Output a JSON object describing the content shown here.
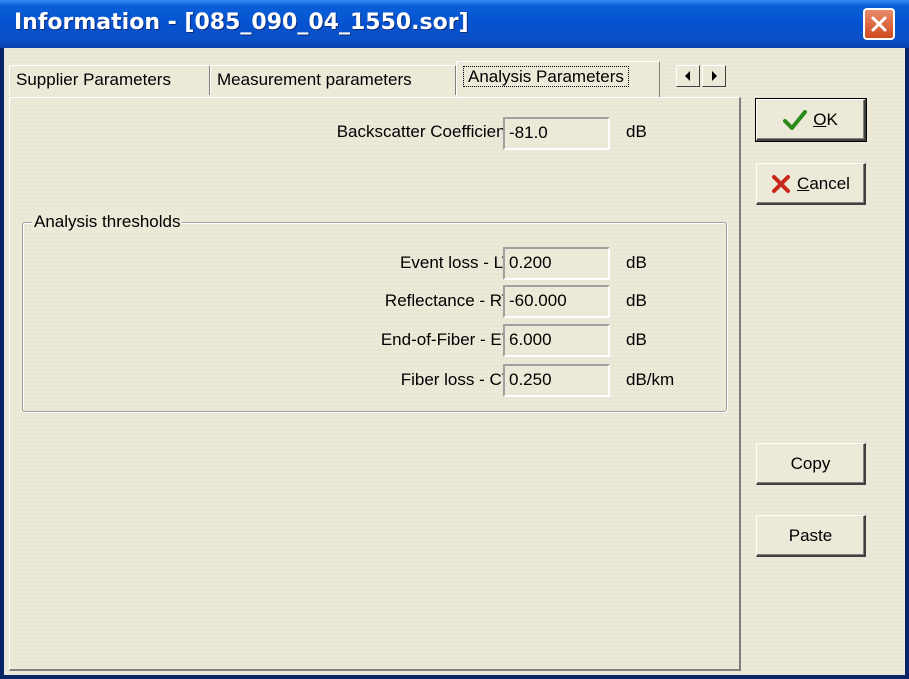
{
  "window": {
    "title": "Information - [085_090_04_1550.sor]"
  },
  "tabs": [
    {
      "label": "Supplier Parameters",
      "active": false
    },
    {
      "label": "Measurement parameters",
      "active": false
    },
    {
      "label": "Analysis Parameters",
      "active": true
    }
  ],
  "backscatter": {
    "label": "Backscatter Coefficient:",
    "value": "-81.0",
    "unit": "dB"
  },
  "thresholds": {
    "title": "Analysis thresholds",
    "rows": [
      {
        "label": "Event loss - LT:",
        "value": "0.200",
        "unit": "dB"
      },
      {
        "label": "Reflectance - RT:",
        "value": "-60.000",
        "unit": "dB"
      },
      {
        "label": "End-of-Fiber - ET:",
        "value": "6.000",
        "unit": "dB"
      },
      {
        "label": "Fiber loss - CT:",
        "value": "0.250",
        "unit": "dB/km"
      }
    ]
  },
  "buttons": {
    "ok": {
      "mnemonic": "O",
      "rest": "K",
      "icon": "checkmark-icon"
    },
    "cancel": {
      "mnemonic": "C",
      "rest": "ancel",
      "icon": "x-icon"
    },
    "copy": "Copy",
    "paste": "Paste"
  },
  "colors": {
    "title_bar": "#0553d0",
    "close_button": "#d04a1c",
    "ok_icon": "#2a8a1a",
    "cancel_icon": "#c8281a",
    "dialog_bg": "#ece9d8"
  }
}
